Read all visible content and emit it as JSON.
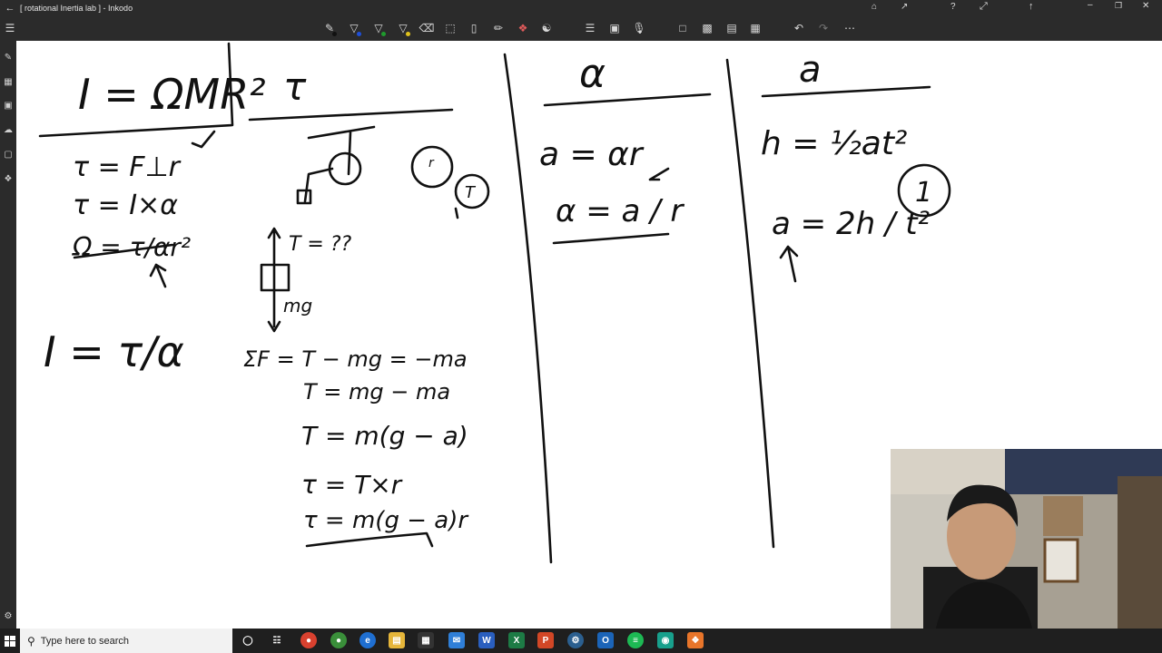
{
  "window": {
    "title": "[ rotational Inertia lab ] - Inkodo"
  },
  "toolbar": {
    "tools": [
      "pen-red",
      "pen-blue",
      "pen-green",
      "highlighter-yellow",
      "eraser",
      "lasso-select",
      "ruler",
      "pencil",
      "shape-tool",
      "fill-tool",
      "settings-sliders",
      "insert-image",
      "microphone",
      "new-page",
      "screenshot",
      "save",
      "clipboard",
      "undo",
      "redo",
      "more"
    ],
    "pen_colors": [
      "#111111",
      "#1e4fd9",
      "#1f9b2d",
      "#e0c21c"
    ]
  },
  "sidebar": {
    "icons": [
      "pen-icon",
      "library-icon",
      "image-icon",
      "cloud-icon",
      "bag-icon",
      "tag-icon"
    ]
  },
  "board": {
    "col1": {
      "heading": "I = ΩMR²",
      "lines": [
        "τ = F⊥r",
        "τ = I×α",
        "Ω = τ/αr²",
        "I = τ/α"
      ]
    },
    "col2": {
      "heading": "τ",
      "lines": [
        "T = ??",
        "mg",
        "ΣF = T − mg = −ma",
        "T = mg − ma",
        "T = m(g − a)",
        "τ = T×r",
        "τ = m(g − a)r"
      ]
    },
    "col3": {
      "heading": "α",
      "lines": [
        "a = αr",
        "α = a / r"
      ]
    },
    "col4": {
      "heading": "a",
      "lines": [
        "h = ½at²",
        "a = 2h / t²",
        "1"
      ]
    }
  },
  "taskbar": {
    "search_placeholder": "Type here to search"
  }
}
